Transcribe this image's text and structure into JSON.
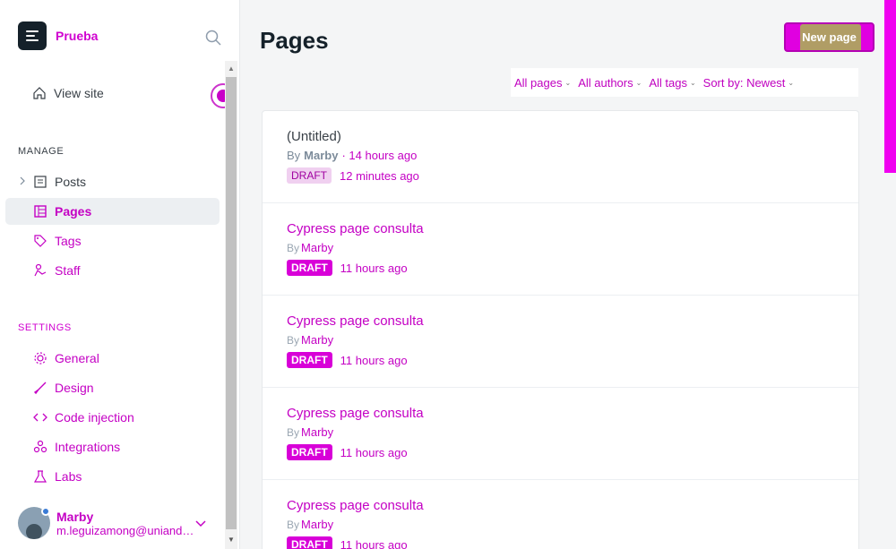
{
  "app": {
    "site_name": "Prueba",
    "colors": {
      "accent": "#d000d0",
      "dark": "#15212a",
      "green_overlay": "#a0d23c"
    }
  },
  "sidebar": {
    "view_site": "View site",
    "manage_label": "MANAGE",
    "manage_items": [
      {
        "label": "Posts",
        "icon": "posts-icon"
      },
      {
        "label": "Pages",
        "icon": "pages-icon",
        "active": true
      },
      {
        "label": "Tags",
        "icon": "tag-icon"
      },
      {
        "label": "Staff",
        "icon": "staff-icon"
      }
    ],
    "settings_label": "SETTINGS",
    "settings_items": [
      {
        "label": "General",
        "icon": "gear-icon"
      },
      {
        "label": "Design",
        "icon": "brush-icon"
      },
      {
        "label": "Code injection",
        "icon": "code-icon"
      },
      {
        "label": "Integrations",
        "icon": "integrations-icon"
      },
      {
        "label": "Labs",
        "icon": "flask-icon"
      }
    ],
    "user": {
      "name": "Marby",
      "email": "m.leguizamong@uniandes.edu.co"
    }
  },
  "main": {
    "title": "Pages",
    "new_button": "New page",
    "filters": {
      "type": "All pages",
      "author": "All authors",
      "tags": "All tags",
      "sort": "Sort by: Newest"
    },
    "pages": [
      {
        "title": "(Untitled)",
        "by": "By",
        "author": "Marby",
        "created": "· 14 hours ago",
        "status": "DRAFT",
        "updated": "12 minutes ago",
        "variant": "soft"
      },
      {
        "title": "Cypress page consulta",
        "by": "By",
        "author": "Marby",
        "created": "",
        "status": "DRAFT",
        "updated": "11 hours ago",
        "variant": "solid"
      },
      {
        "title": "Cypress page consulta",
        "by": "By",
        "author": "Marby",
        "created": "",
        "status": "DRAFT",
        "updated": "11 hours ago",
        "variant": "solid"
      },
      {
        "title": "Cypress page consulta",
        "by": "By",
        "author": "Marby",
        "created": "",
        "status": "DRAFT",
        "updated": "11 hours ago",
        "variant": "solid"
      },
      {
        "title": "Cypress page consulta",
        "by": "By",
        "author": "Marby",
        "created": "",
        "status": "DRAFT",
        "updated": "11 hours ago",
        "variant": "solid"
      }
    ]
  }
}
